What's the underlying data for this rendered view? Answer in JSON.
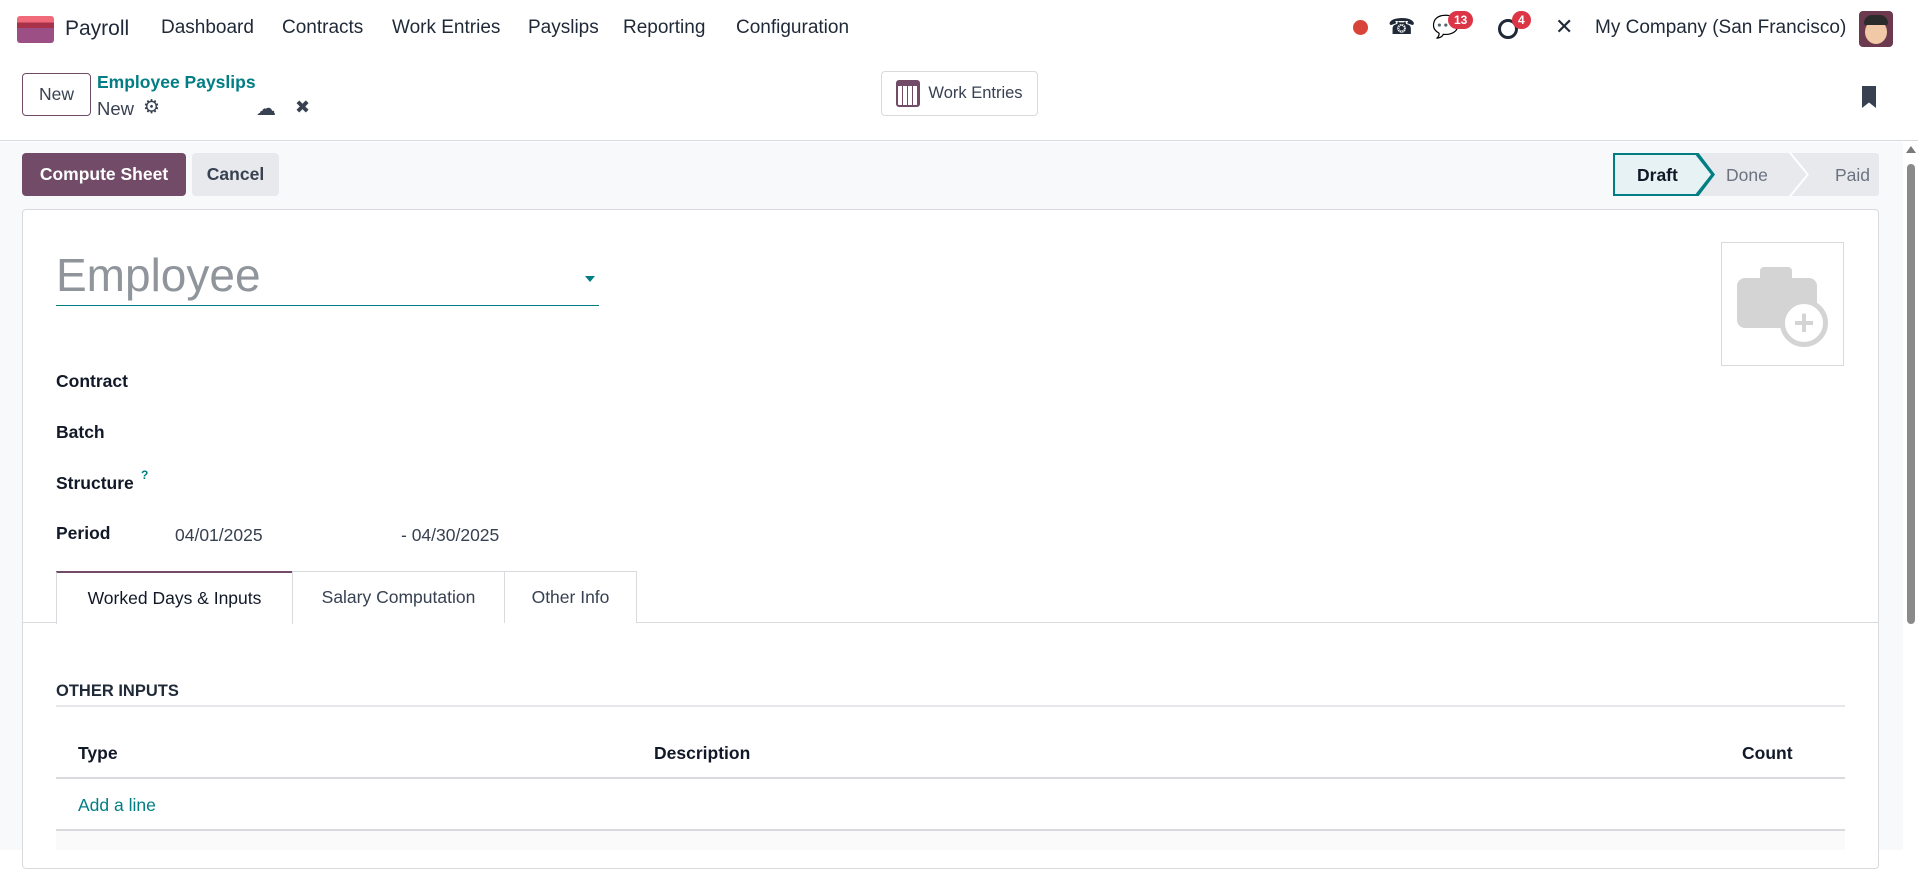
{
  "navbar": {
    "app_name": "Payroll",
    "menu": [
      "Dashboard",
      "Contracts",
      "Work Entries",
      "Payslips",
      "Reporting",
      "Configuration"
    ],
    "messages_count": "13",
    "activities_count": "4",
    "company": "My Company (San Francisco)"
  },
  "control_panel": {
    "new_label": "New",
    "breadcrumb_parent": "Employee Payslips",
    "breadcrumb_current": "New",
    "work_entries_label": "Work Entries"
  },
  "actions": {
    "compute_sheet": "Compute Sheet",
    "cancel": "Cancel"
  },
  "status": {
    "stages": [
      "Draft",
      "Done",
      "Paid"
    ],
    "current": "Draft"
  },
  "form": {
    "employee_placeholder": "Employee",
    "contract_label": "Contract",
    "batch_label": "Batch",
    "structure_label": "Structure",
    "structure_help": "?",
    "period_label": "Period",
    "period_start": "04/01/2025",
    "period_end": "- 04/30/2025"
  },
  "tabs": [
    "Worked Days & Inputs",
    "Salary Computation",
    "Other Info"
  ],
  "other_inputs": {
    "title": "OTHER INPUTS",
    "columns": [
      "Type",
      "Description",
      "Count"
    ],
    "add_line": "Add a line"
  },
  "colors": {
    "brand": "#714b67",
    "accent": "#017e84"
  }
}
